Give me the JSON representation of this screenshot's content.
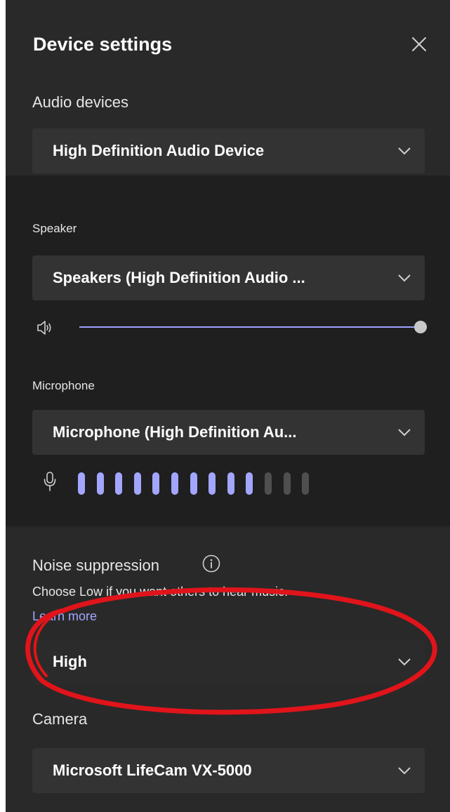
{
  "header": {
    "title": "Device settings"
  },
  "audio_devices": {
    "label": "Audio devices",
    "selected": "High Definition Audio Device"
  },
  "speaker": {
    "label": "Speaker",
    "selected": "Speakers (High Definition Audio ...",
    "volume_percent": 100
  },
  "microphone": {
    "label": "Microphone",
    "selected": "Microphone (High Definition Au...",
    "level_bars_total": 13,
    "level_bars_active": 10
  },
  "noise_suppression": {
    "label": "Noise suppression",
    "hint": "Choose Low if you want others to hear music.",
    "link": "Learn more",
    "selected": "High"
  },
  "camera": {
    "label": "Camera",
    "selected": "Microsoft LifeCam VX-5000"
  },
  "icons": {
    "close": "close-icon",
    "dropdown": "chevron-down-icon",
    "speaker": "speaker-icon",
    "microphone": "microphone-icon",
    "info": "info-icon"
  },
  "colors": {
    "panel": "#292929",
    "panel_dark": "#1f1f1f",
    "dropdown": "#333333",
    "accent": "#a2a6ff",
    "annotation": "#e0141a"
  }
}
